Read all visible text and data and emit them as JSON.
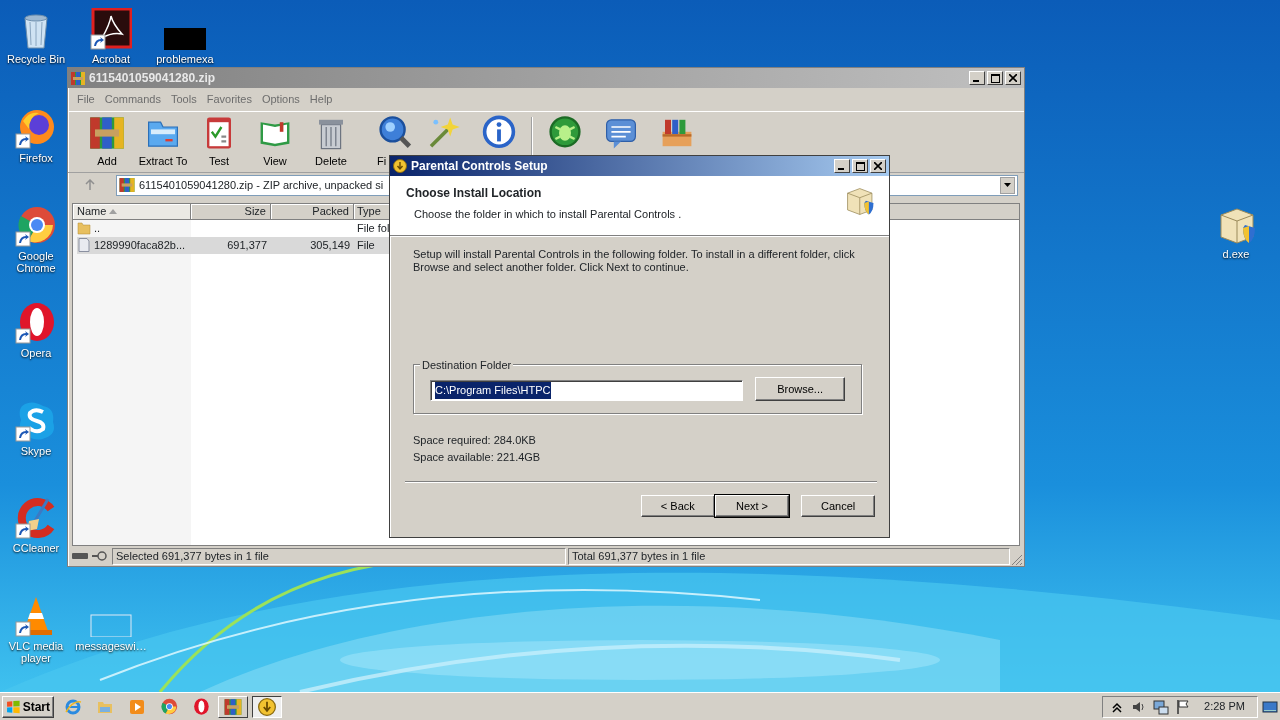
{
  "desktop_icons": [
    {
      "label": "Recycle Bin",
      "kind": "recycle",
      "shortcut": false
    },
    {
      "label": "Acrobat",
      "kind": "acrobat",
      "shortcut": true
    },
    {
      "label": "problemexa",
      "kind": "black-thumb",
      "shortcut": false
    },
    {
      "label": "Firefox",
      "kind": "firefox",
      "shortcut": true
    },
    {
      "label": "Google Chrome",
      "kind": "chrome",
      "shortcut": true
    },
    {
      "label": "Opera",
      "kind": "opera",
      "shortcut": true
    },
    {
      "label": "Skype",
      "kind": "skype",
      "shortcut": true
    },
    {
      "label": "CCleaner",
      "kind": "ccleaner",
      "shortcut": true
    },
    {
      "label": "VLC media player",
      "kind": "vlc",
      "shortcut": true
    },
    {
      "label": "messageswi…",
      "kind": "blank-thumb",
      "shortcut": false
    },
    {
      "label": "d.exe",
      "kind": "installer",
      "shortcut": false
    }
  ],
  "archive_window": {
    "title": "6115401059041280.zip",
    "active": false,
    "menu": [
      "File",
      "Commands",
      "Tools",
      "Favorites",
      "Options",
      "Help"
    ],
    "toolbar": [
      {
        "label": "Add",
        "kind": "add"
      },
      {
        "label": "Extract To",
        "kind": "extract"
      },
      {
        "label": "Test",
        "kind": "test"
      },
      {
        "label": "View",
        "kind": "view"
      },
      {
        "label": "Delete",
        "kind": "delete"
      },
      {
        "label": "Fi",
        "kind": "find"
      },
      {
        "kind": "wizard"
      },
      {
        "kind": "info"
      },
      {
        "kind": "separator"
      },
      {
        "kind": "virus"
      },
      {
        "kind": "comment"
      },
      {
        "kind": "sfx"
      }
    ],
    "address": "6115401059041280.zip - ZIP archive, unpacked si",
    "columns": [
      {
        "label": "Name",
        "sorted": true
      },
      {
        "label": "Size",
        "sorted": false
      },
      {
        "label": "Packed",
        "sorted": false
      },
      {
        "label": "Type",
        "sorted": false
      }
    ],
    "rows": [
      {
        "kind": "parent",
        "name": "..",
        "type": "File fol",
        "selected": false
      },
      {
        "kind": "file",
        "name": "1289990faca82b...",
        "size": "691,377",
        "packed": "305,149",
        "type": "File",
        "selected": true
      }
    ],
    "status": [
      "Selected 691,377 bytes in 1 file",
      "Total 691,377 bytes in 1 file"
    ]
  },
  "setup_dialog": {
    "title": "Parental Controls  Setup",
    "active": true,
    "heading": "Choose Install Location",
    "subheading": "Choose the folder in which to install Parental Controls .",
    "body": "Setup will install Parental Controls  in the following folder. To install in a different folder, click Browse and select another folder. Click Next to continue.",
    "group_label": "Destination Folder",
    "folder": {
      "value": "C:\\Program Files\\HTPC",
      "selected": true
    },
    "browse": "Browse...",
    "space_required": "Space required: 284.0KB",
    "space_available": "Space available: 221.4GB",
    "buttons": [
      {
        "label": "< Back",
        "default": false
      },
      {
        "label": "Next >",
        "default": true
      },
      {
        "label": "Cancel",
        "default": false
      }
    ]
  },
  "taskbar": {
    "start": "Start",
    "quick_launch": [
      {
        "kind": "ie"
      },
      {
        "kind": "explorer"
      },
      {
        "kind": "media"
      },
      {
        "kind": "chrome"
      },
      {
        "kind": "opera"
      }
    ],
    "tasks": [
      {
        "kind": "winrar",
        "selected": false
      },
      {
        "kind": "setup",
        "selected": true
      }
    ],
    "clock": "2:28 PM"
  }
}
